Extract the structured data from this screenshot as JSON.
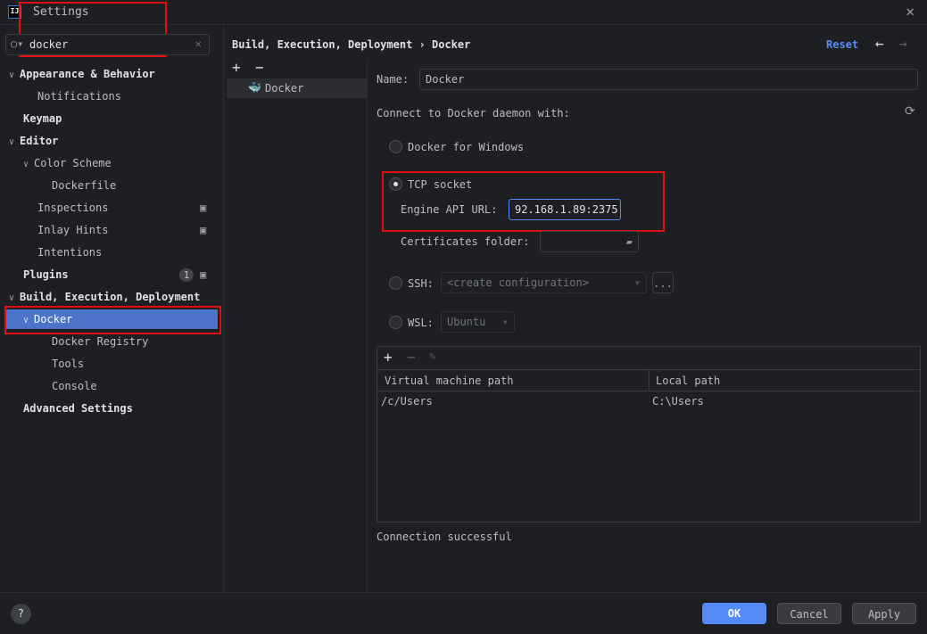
{
  "window": {
    "title": "Settings",
    "logo": "IJ"
  },
  "search": {
    "value": "docker"
  },
  "sidebar": {
    "items": [
      {
        "label": "Appearance & Behavior"
      },
      {
        "label": "Notifications"
      },
      {
        "label": "Keymap"
      },
      {
        "label": "Editor"
      },
      {
        "label": "Color Scheme"
      },
      {
        "label": "Dockerfile"
      },
      {
        "label": "Inspections"
      },
      {
        "label": "Inlay Hints"
      },
      {
        "label": "Intentions"
      },
      {
        "label": "Plugins",
        "badge": "1"
      },
      {
        "label": "Build, Execution, Deployment"
      },
      {
        "label": "Docker"
      },
      {
        "label": "Docker Registry"
      },
      {
        "label": "Tools"
      },
      {
        "label": "Console"
      },
      {
        "label": "Advanced Settings"
      }
    ]
  },
  "breadcrumb": {
    "parent": "Build, Execution, Deployment",
    "sep": "›",
    "current": "Docker"
  },
  "header": {
    "reset": "Reset"
  },
  "servers": {
    "add": "+",
    "remove": "−",
    "items": [
      "Docker"
    ]
  },
  "form": {
    "name_label": "Name:",
    "name_value": "Docker",
    "connect_label": "Connect to Docker daemon with:",
    "docker_windows": "Docker for Windows",
    "tcp_socket": "TCP socket",
    "engine_label": "Engine API URL:",
    "engine_value": "92.168.1.89:2375",
    "certs_label": "Certificates folder:",
    "ssh_label": "SSH:",
    "ssh_value": "<create configuration>",
    "ssh_more": "...",
    "wsl_label": "WSL:",
    "wsl_value": "Ubuntu",
    "status": "Connection successful"
  },
  "mappings": {
    "add": "+",
    "remove": "−",
    "columns": [
      "Virtual machine path",
      "Local path"
    ],
    "rows": [
      [
        "/c/Users",
        "C:\\Users"
      ]
    ]
  },
  "footer": {
    "help": "?",
    "ok": "OK",
    "cancel": "Cancel",
    "apply": "Apply"
  }
}
